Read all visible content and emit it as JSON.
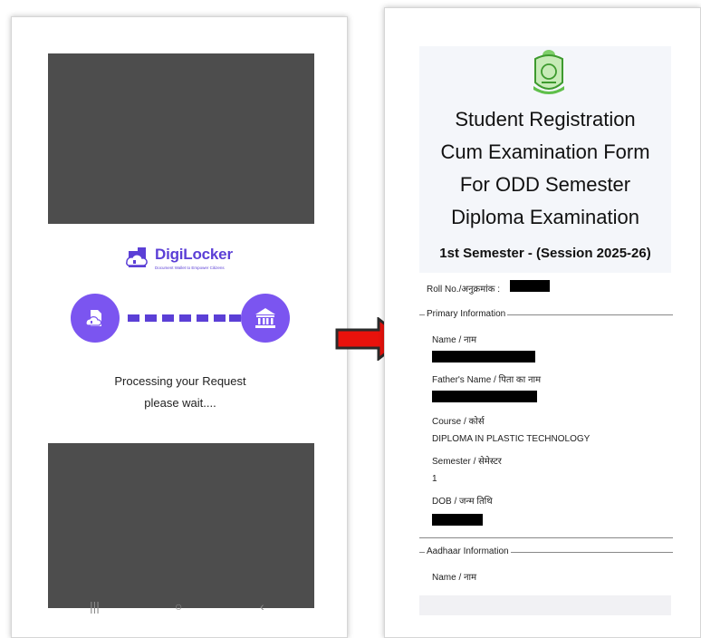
{
  "left_screen": {
    "brand": {
      "name": "DigiLocker",
      "tagline": "Document Wallet to Empower Citizens"
    },
    "status_title": "Processing your Request",
    "status_sub": "please wait....",
    "nav_icons": [
      "menu-icon",
      "home-icon",
      "back-icon"
    ]
  },
  "right_screen": {
    "title_lines": [
      "Student Registration",
      "Cum Examination Form",
      "For ODD Semester",
      "Diploma Examination"
    ],
    "semester_line": "1st Semester - (Session 2025-26)",
    "roll_label": "Roll No./अनुक्रमांक :",
    "sections": {
      "primary": "Primary Information",
      "aadhaar": "Aadhaar Information"
    },
    "fields": {
      "name_label": "Name / नाम",
      "father_label": "Father's Name / पिता का नाम",
      "course_label": "Course / कोर्स",
      "course_value": "DIPLOMA IN PLASTIC TECHNOLOGY",
      "semester_label": "Semester / सेमेस्टर",
      "semester_value": "1",
      "dob_label": "DOB / जन्म तिथि",
      "aadhaar_name_label": "Name / नाम"
    }
  },
  "colors": {
    "brand_purple": "#5b3fd6",
    "circle_purple": "#7b55f0",
    "arrow_red": "#e8120c",
    "redaction_gray": "#4d4d4d"
  }
}
